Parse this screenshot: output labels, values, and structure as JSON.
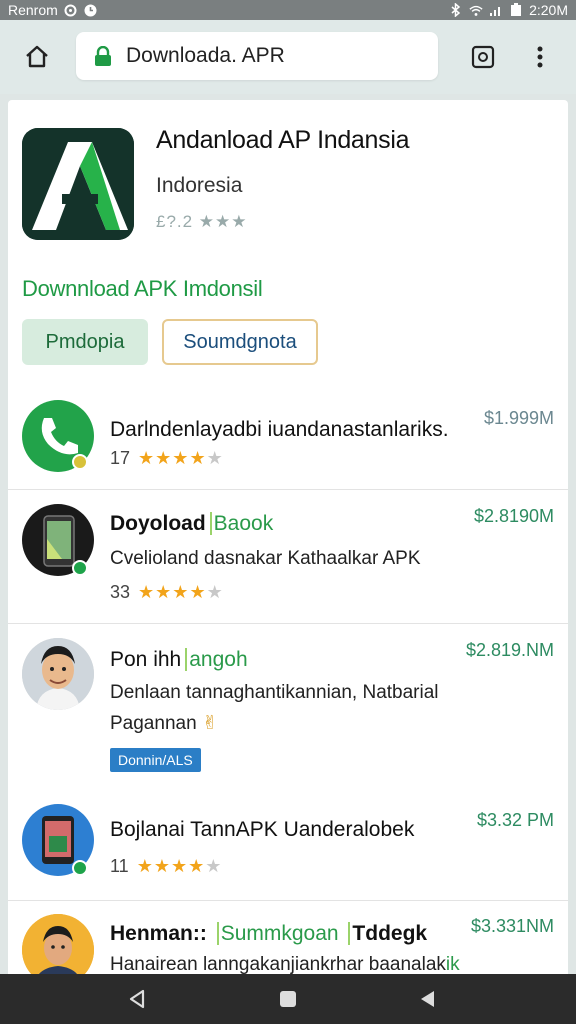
{
  "status_bar": {
    "carrier": "Renrom",
    "time": "2:20M"
  },
  "browser": {
    "url": "Downloada. APR"
  },
  "hero": {
    "title": "Andanload AP Indansia",
    "subtitle": "Indoresia",
    "rating": "£?.2 ★★★",
    "promo_link": "Downnload APK Imdonsil",
    "primary_button": "Pmdopia",
    "secondary_button": "Soumdgnota"
  },
  "apps": [
    {
      "title": "Darlndenlayadbi iuandanastanlariks.",
      "price": "$1.999M",
      "rating_count": "17",
      "stars": 4
    },
    {
      "title": "Doyoload",
      "title_highlight": "Baook",
      "description": "Cvelioland dasnakar Kathaalkar APK",
      "price": "$2.8190M",
      "rating_count": "33",
      "stars": 4
    },
    {
      "title": "Pon ihh",
      "title_highlight": "angoh",
      "description": "Denlaan tannaghantikannian, Natbarial",
      "description2": "Pagannan",
      "price": "$2.819.NM",
      "tag": "Donnin/ALS"
    },
    {
      "title": "Bojlanai TannAPK Uanderalobek",
      "price": "$3.32 PM",
      "rating_count": "11",
      "stars": 4
    },
    {
      "title": "Henman::",
      "title_highlight": "Summkgoan",
      "title_suffix": "Tddegk",
      "description": "Hanairean lanngakanjiankrhar baanalak",
      "description_highlight": "ik",
      "price": "$3.331NM"
    }
  ],
  "colors": {
    "accent_green": "#1f9a45",
    "price_green": "#2d8b61",
    "star": "#f2a41b",
    "tag_blue": "#2b7ec6"
  }
}
